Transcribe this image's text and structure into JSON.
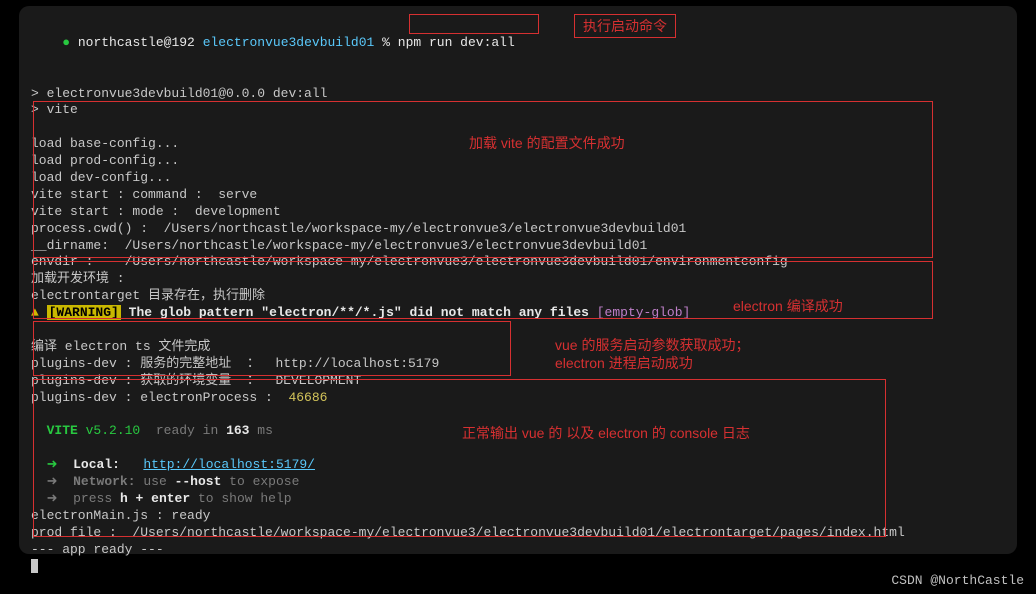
{
  "prompt": {
    "user_host": "northcastle@192",
    "cwd": "electronvue3devbuild01",
    "symbol": "%",
    "command": "npm run dev:all"
  },
  "output": {
    "script_line1": "> electronvue3devbuild01@0.0.0 dev:all",
    "script_line2": "> vite",
    "load1": "load base-config...",
    "load2": "load prod-config...",
    "load3": "load dev-config...",
    "vite_start1": "vite start : command :  serve",
    "vite_start2": "vite start : mode :  development",
    "cwd_line": "process.cwd() :  /Users/northcastle/workspace-my/electronvue3/electronvue3devbuild01",
    "dirname_line": "__dirname:  /Users/northcastle/workspace-my/electronvue3/electronvue3devbuild01",
    "envdir_line": "envdir :    /Users/northcastle/workspace-my/electronvue3/electronvue3devbuild01/environmentconfig",
    "load_env_cn": "加载开发环境 :",
    "electrontarget_cn": "electrontarget 目录存在，执行删除",
    "warning_prefix": "[WARNING]",
    "warning_msg": " The glob pattern \"electron/**/*.js\" did not match any files",
    "warning_suffix": " [empty-glob]",
    "compile_cn": "编译 electron ts 文件完成",
    "plugin1_label": "plugins-dev : 服务的完整地址  ：  ",
    "plugin1_value": "http://localhost:5179",
    "plugin2_label": "plugins-dev : 获取的环境变量  ：  ",
    "plugin2_value": "DEVELOPMENT",
    "plugin3_label": "plugins-dev : electronProcess :  ",
    "plugin3_value": "46686",
    "vite_label": "VITE",
    "vite_version": " v5.2.10",
    "vite_ready": "  ready in ",
    "vite_ms": "163",
    "vite_ms_suffix": " ms",
    "local_label": "Local:",
    "local_url": "http://localhost:5179/",
    "network_label": "Network:",
    "network_hint_pre": " use ",
    "network_flag": "--host",
    "network_hint_post": " to expose",
    "help_pre": "press ",
    "help_key": "h + enter",
    "help_post": " to show help",
    "electron_main": "electronMain.js : ready",
    "prod_file": "prod file :  /Users/northcastle/workspace-my/electronvue3/electronvue3devbuild01/electrontarget/pages/index.html",
    "app_ready": "--- app ready ---"
  },
  "annotations": {
    "a1": "执行启动命令",
    "a2": "加载 vite 的配置文件成功",
    "a3": "electron 编译成功",
    "a4_line1": "vue 的服务启动参数获取成功；",
    "a4_line2": "electron 进程启动成功",
    "a5": "正常输出 vue 的 以及 electron 的 console 日志"
  },
  "watermark": "CSDN @NorthCastle"
}
